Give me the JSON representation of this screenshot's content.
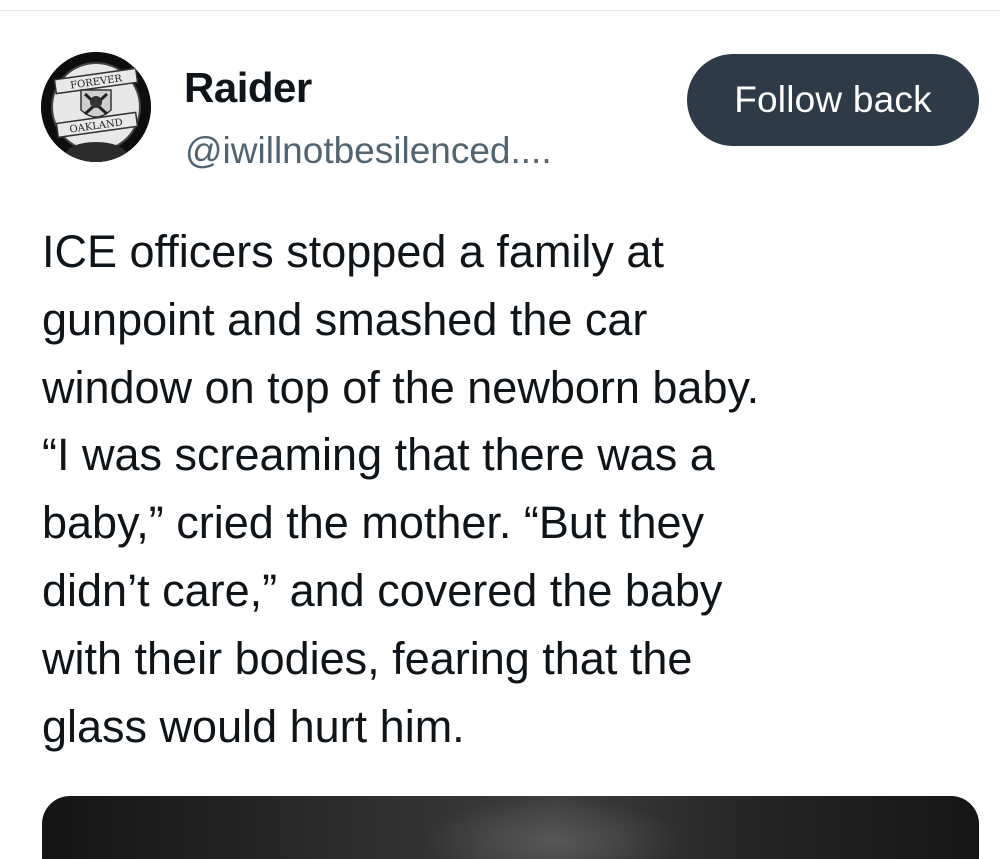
{
  "post": {
    "author": {
      "display_name": "Raider",
      "handle": "@iwillnotbesilenced....",
      "avatar_logo_text_top": "FOREVER",
      "avatar_logo_text_bottom": "OAKLAND"
    },
    "follow_button_label": "Follow back",
    "text": "ICE officers stopped a family at\ngunpoint and smashed the car\nwindow on top of the newborn baby.\n“I was screaming that there was a\nbaby,” cried the mother. “But they\ndidn’t care,” and covered the baby\nwith their bodies, fearing that the\nglass would hurt him."
  },
  "colors": {
    "follow_button_bg": "#2e3a48",
    "handle_text": "#536471",
    "primary_text": "#0f1419"
  }
}
